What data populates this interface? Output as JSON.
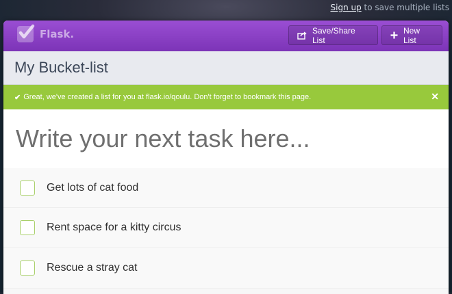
{
  "topbar": {
    "signup_link": "Sign up",
    "signup_suffix": " to save multiple lists"
  },
  "header": {
    "logo_text": "Flask.",
    "save_share_label": "Save/Share List",
    "new_list_label": "New List",
    "brand_color": "#8a3fc6"
  },
  "list": {
    "title": "My Bucket-list"
  },
  "notice": {
    "icon": "checkmark",
    "text": "Great, we've created a list for you at flask.io/qoulu. Don't forget to bookmark this page.",
    "close_glyph": "✕",
    "color": "#98c93c"
  },
  "new_task": {
    "placeholder": "Write your next task here..."
  },
  "tasks": [
    {
      "label": "Get lots of cat food",
      "checked": false
    },
    {
      "label": "Rent space for a kitty circus",
      "checked": false
    },
    {
      "label": "Rescue a stray cat",
      "checked": false
    }
  ]
}
